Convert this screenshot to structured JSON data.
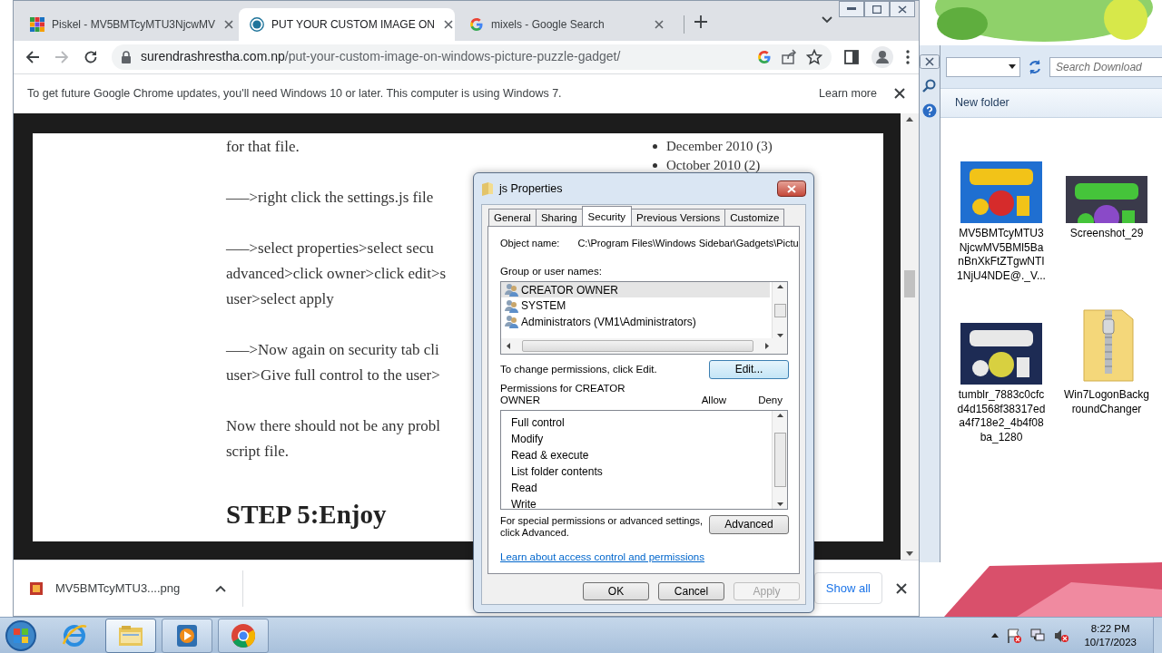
{
  "browser": {
    "tabs": [
      {
        "title": "Piskel - MV5BMTcyMTU3NjcwMV",
        "selected": false
      },
      {
        "title": "PUT YOUR CUSTOM IMAGE ON",
        "selected": true
      },
      {
        "title": "mixels - Google Search",
        "selected": false
      }
    ],
    "address": {
      "domain": "surendrashrestha.com.np",
      "path": "/put-your-custom-image-on-windows-picture-puzzle-gadget/"
    },
    "infobar": {
      "text": "To get future Google Chrome updates, you'll need Windows 10 or later. This computer is using Windows 7.",
      "link": "Learn more"
    },
    "article": {
      "paragraphs": [
        [
          "for that file."
        ],
        [
          "—–>right click the settings.js file"
        ],
        [
          "—–>select properties>select secu",
          "advanced>click owner>click edit>s",
          "user>select apply"
        ],
        [
          "—–>Now again on security tab cli",
          "user>Give full control to the user>"
        ],
        [
          "Now there should not be any probl",
          "script file."
        ]
      ],
      "heading": "STEP 5:Enjoy"
    },
    "archive": [
      {
        "month": "December 2010",
        "count": "(3)"
      },
      {
        "month": "October 2010",
        "count": "(2)"
      }
    ],
    "downloads": {
      "file": "MV5BMTcyMTU3....png",
      "show_all": "Show all"
    }
  },
  "dialog": {
    "title": "js Properties",
    "tabs": [
      {
        "label": "General",
        "selected": false
      },
      {
        "label": "Sharing",
        "selected": false
      },
      {
        "label": "Security",
        "selected": true
      },
      {
        "label": "Previous Versions",
        "selected": false
      },
      {
        "label": "Customize",
        "selected": false
      }
    ],
    "object_label": "Object name:",
    "object_value": "C:\\Program Files\\Windows Sidebar\\Gadgets\\Pictu",
    "groups_label": "Group or user names:",
    "groups": [
      {
        "name": "CREATOR OWNER",
        "selected": true
      },
      {
        "name": "SYSTEM",
        "selected": false
      },
      {
        "name": "Administrators (VM1\\Administrators)",
        "selected": false
      }
    ],
    "change_text": "To change permissions, click Edit.",
    "edit_button": "Edit...",
    "perm_label": [
      "Permissions for CREATOR",
      "OWNER"
    ],
    "allow": "Allow",
    "deny": "Deny",
    "permissions": [
      "Full control",
      "Modify",
      "Read & execute",
      "List folder contents",
      "Read",
      "Write"
    ],
    "advanced_text": [
      "For special permissions or advanced settings,",
      "click Advanced."
    ],
    "advanced_button": "Advanced",
    "learn_link": "Learn about access control and permissions",
    "buttons": [
      {
        "label": "OK",
        "disabled": false
      },
      {
        "label": "Cancel",
        "disabled": false
      },
      {
        "label": "Apply",
        "disabled": true
      }
    ]
  },
  "explorer": {
    "search_placeholder": "Search Download",
    "new_folder": "New folder",
    "files": [
      {
        "name": "MV5BMTcyMTU3NjcwMV5BMl5BanBnXkFtZTgwNTI1NjU4NDE@._V...",
        "kind": "picture"
      },
      {
        "name": "Screenshot_29",
        "kind": "picture"
      },
      {
        "name": "tumblr_7883c0cfcd4d1568f38317eda4f718e2_4b4f08ba_1280",
        "kind": "picture"
      },
      {
        "name": "Win7LogonBackgroundChanger",
        "kind": "zip"
      }
    ]
  },
  "taskbar": {
    "apps": [
      {
        "kind": "ie",
        "running": false,
        "selected": false
      },
      {
        "kind": "explorer",
        "running": true,
        "selected": true
      },
      {
        "kind": "media",
        "running": true,
        "selected": false
      },
      {
        "kind": "chrome",
        "running": true,
        "selected": false
      }
    ],
    "time": "8:22 PM",
    "date": "10/17/2023"
  }
}
